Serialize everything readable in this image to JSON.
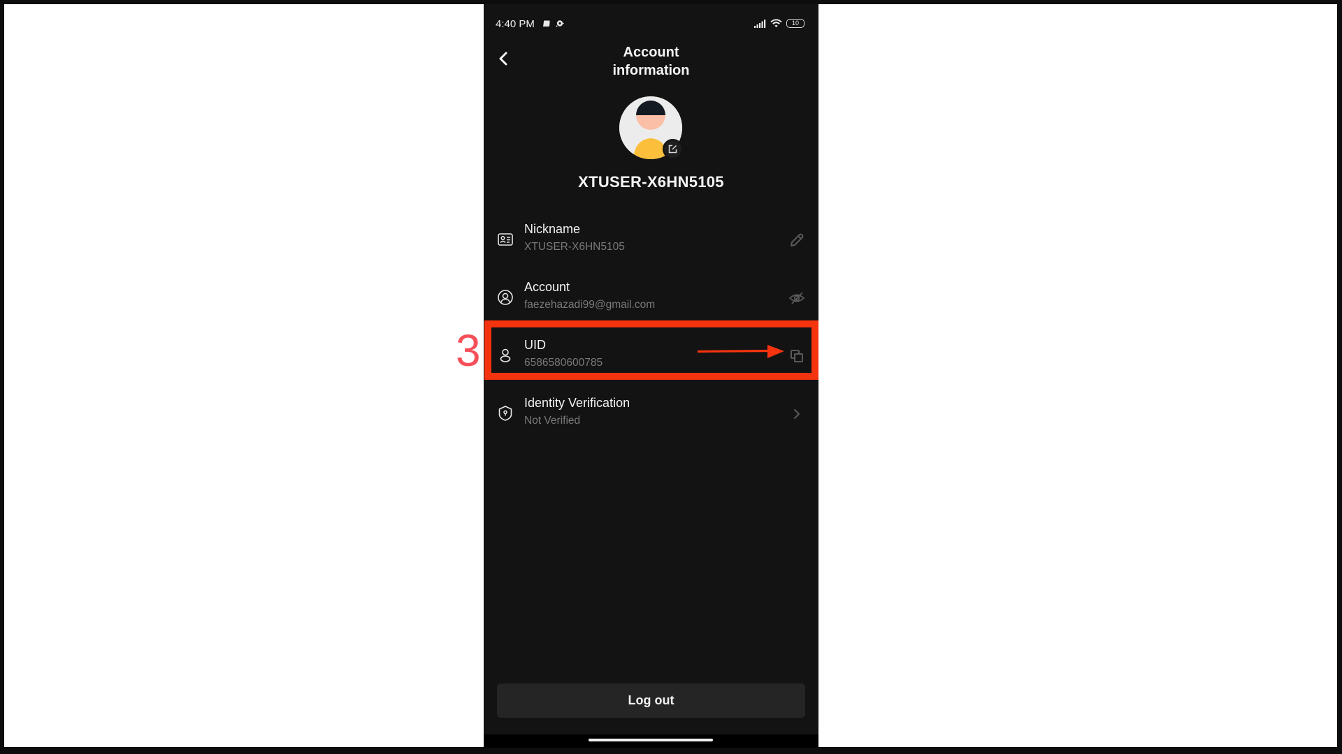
{
  "status_bar": {
    "time": "4:40 PM",
    "battery": "10",
    "icons": [
      "notification-app-icon",
      "notification-chat-icon",
      "signal-icon",
      "wifi-icon",
      "battery-icon"
    ]
  },
  "header": {
    "back_icon": "chevron-left-icon",
    "title": "Account information"
  },
  "profile": {
    "avatar_icon": "default-avatar",
    "edit_icon": "edit-icon",
    "username": "XTUSER-X6HN5105"
  },
  "rows": [
    {
      "icon": "id-card-icon",
      "title": "Nickname",
      "value": "XTUSER-X6HN5105",
      "action_icon": "pencil-icon"
    },
    {
      "icon": "user-circle-icon",
      "title": "Account",
      "value": "faezehazadi99@gmail.com",
      "action_icon": "eye-off-icon"
    },
    {
      "icon": "user-icon",
      "title": "UID",
      "value": "6586580600785",
      "action_icon": "copy-icon"
    },
    {
      "icon": "shield-icon",
      "title": "Identity Verification",
      "value": "Not Verified",
      "action_icon": "chevron-right-icon"
    }
  ],
  "footer": {
    "logout_label": "Log out"
  },
  "annotation": {
    "step_number": "3",
    "highlight_color": "#f5340f",
    "step_color": "#f5505a",
    "target": "UID copy button"
  },
  "colors": {
    "background": "#131313",
    "text_primary": "#f2f2f2",
    "text_secondary": "#7a7a7a",
    "button_bg": "#252525",
    "avatar_hair": "#141a22",
    "avatar_face": "#fbbfa8",
    "avatar_body": "#fbbf3b"
  }
}
